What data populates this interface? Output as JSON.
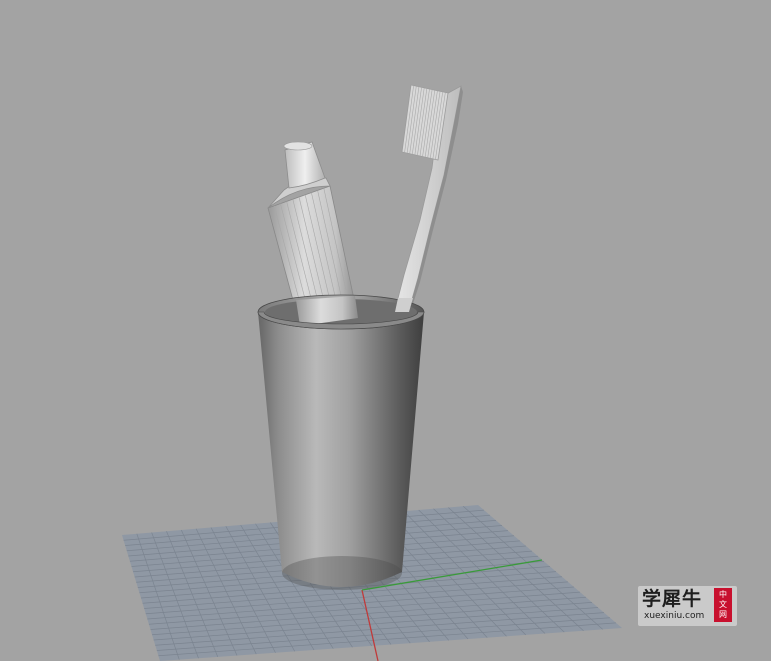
{
  "viewport": {
    "background_color": "#a3a3a3",
    "grid_color": "#8f98a4",
    "grid_line_color": "#7b8490",
    "x_axis_color": "#c03a3a",
    "y_axis_color": "#3a9a3a"
  },
  "scene": {
    "objects": [
      "cup",
      "toothpaste-tube",
      "toothbrush"
    ]
  },
  "watermark": {
    "main_text": "学犀牛",
    "seal_chars": [
      "中",
      "文",
      "网"
    ],
    "url": "xuexiniu.com"
  }
}
